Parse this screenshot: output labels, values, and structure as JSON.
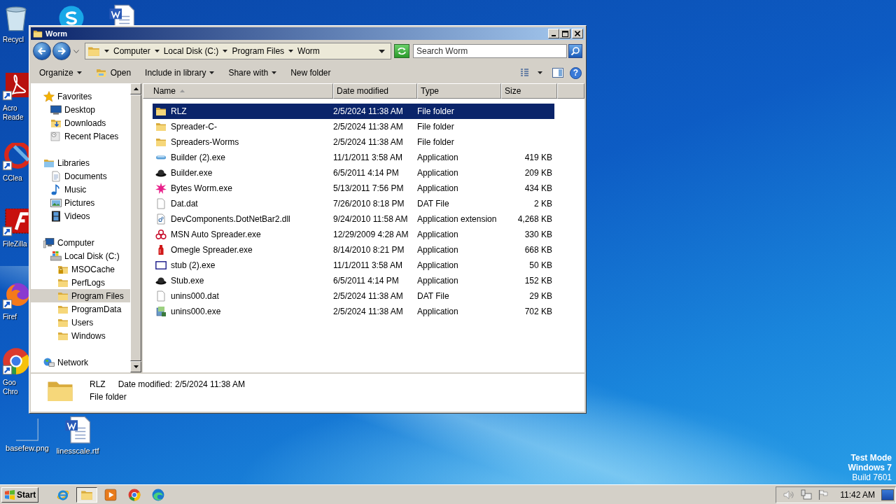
{
  "desktop": {
    "icons": [
      {
        "kind": "recycle",
        "label": "Recycl"
      },
      {
        "kind": "skype"
      },
      {
        "kind": "word"
      },
      {
        "kind": "acrobat",
        "label": "Acro Reade"
      },
      {
        "kind": "ccleaner",
        "label": "CClea"
      },
      {
        "kind": "filezilla",
        "label": "FileZilla"
      },
      {
        "kind": "firefox",
        "label": "Firef"
      },
      {
        "kind": "chrome",
        "label": "Goo Chro"
      },
      {
        "kind": "image",
        "label": "basefew.png"
      },
      {
        "kind": "word",
        "label": "linesscale.rtf"
      }
    ],
    "os_notice": {
      "title": "Test Mode",
      "edition": "Windows 7",
      "build": "Build 7601"
    }
  },
  "window": {
    "title": "Worm",
    "address": [
      "Computer",
      "Local Disk (C:)",
      "Program Files",
      "Worm"
    ],
    "search": {
      "placeholder": "Search Worm"
    },
    "toolbar": [
      {
        "label": "Organize",
        "kind": "menu"
      },
      {
        "label": "Open",
        "kind": "open"
      },
      {
        "label": "Include in library",
        "kind": "menu"
      },
      {
        "label": "Share with",
        "kind": "menu"
      },
      {
        "label": "New folder",
        "kind": "plain"
      }
    ],
    "help": "?",
    "nav": [
      {
        "label": "Favorites",
        "kind": "star",
        "selected": false,
        "children": [
          {
            "label": "Desktop",
            "kind": "monitor",
            "selected": false
          },
          {
            "label": "Downloads",
            "kind": "downloads",
            "selected": false
          },
          {
            "label": "Recent Places",
            "kind": "recent",
            "selected": false
          }
        ]
      },
      {
        "label": "Libraries",
        "kind": "library",
        "selected": false,
        "children": [
          {
            "label": "Documents",
            "kind": "documents",
            "selected": false
          },
          {
            "label": "Music",
            "kind": "music",
            "selected": false
          },
          {
            "label": "Pictures",
            "kind": "pictures",
            "selected": false
          },
          {
            "label": "Videos",
            "kind": "videos",
            "selected": false
          }
        ]
      },
      {
        "label": "Computer",
        "kind": "computer",
        "selected": false,
        "children": [
          {
            "label": "Local Disk (C:)",
            "kind": "drive",
            "selected": false,
            "children": [
              {
                "label": "MSOCache",
                "kind": "lockfolder",
                "selected": false
              },
              {
                "label": "PerfLogs",
                "kind": "folder",
                "selected": false
              },
              {
                "label": "Program Files",
                "kind": "folder",
                "selected": true
              },
              {
                "label": "ProgramData",
                "kind": "folder",
                "selected": false
              },
              {
                "label": "Users",
                "kind": "folder",
                "selected": false
              },
              {
                "label": "Windows",
                "kind": "folder",
                "selected": false
              }
            ]
          }
        ]
      },
      {
        "label": "Network",
        "kind": "network",
        "selected": false
      }
    ],
    "columns": [
      {
        "label": "Name",
        "sorted": true
      },
      {
        "label": "Date modified",
        "sorted": false
      },
      {
        "label": "Type",
        "sorted": false
      },
      {
        "label": "Size",
        "sorted": false
      }
    ],
    "rows": [
      {
        "name": "RLZ",
        "kind": "folder",
        "date": "2/5/2024 11:38 AM",
        "type": "File folder",
        "selected": true
      },
      {
        "name": "Spreader-C-",
        "kind": "folder",
        "date": "2/5/2024 11:38 AM",
        "type": "File folder",
        "selected": false
      },
      {
        "name": "Spreaders-Worms",
        "kind": "folder",
        "date": "2/5/2024 11:38 AM",
        "type": "File folder",
        "selected": false
      },
      {
        "name": "Builder (2).exe",
        "kind": "capsule",
        "date": "11/1/2011 3:58 AM",
        "type": "Application",
        "size": "419 KB",
        "selected": false
      },
      {
        "name": "Builder.exe",
        "kind": "hat",
        "date": "6/5/2011 4:14 PM",
        "type": "Application",
        "size": "209 KB",
        "selected": false
      },
      {
        "name": "Bytes Worm.exe",
        "kind": "splat",
        "date": "5/13/2011 7:56 PM",
        "type": "Application",
        "size": "434 KB",
        "selected": false
      },
      {
        "name": "Dat.dat",
        "kind": "file",
        "date": "7/26/2010 8:18 PM",
        "type": "DAT File",
        "size": "2 KB",
        "selected": false
      },
      {
        "name": "DevComponents.DotNetBar2.dll",
        "kind": "dll",
        "date": "9/24/2010 11:58 AM",
        "type": "Application extension",
        "size": "4,268 KB",
        "selected": false
      },
      {
        "name": "MSN Auto Spreader.exe",
        "kind": "biohazard",
        "date": "12/29/2009 4:28 AM",
        "type": "Application",
        "size": "330 KB",
        "selected": false
      },
      {
        "name": "Omegle Spreader.exe",
        "kind": "bottle",
        "date": "8/14/2010 8:21 PM",
        "type": "Application",
        "size": "668 KB",
        "selected": false
      },
      {
        "name": "stub (2).exe",
        "kind": "window",
        "date": "11/1/2011 3:58 AM",
        "type": "Application",
        "size": "50 KB",
        "selected": false
      },
      {
        "name": "Stub.exe",
        "kind": "hat",
        "date": "6/5/2011 4:14 PM",
        "type": "Application",
        "size": "152 KB",
        "selected": false
      },
      {
        "name": "unins000.dat",
        "kind": "file",
        "date": "2/5/2024 11:38 AM",
        "type": "DAT File",
        "size": "29 KB",
        "selected": false
      },
      {
        "name": "unins000.exe",
        "kind": "installer",
        "date": "2/5/2024 11:38 AM",
        "type": "Application",
        "size": "702 KB",
        "selected": false
      }
    ],
    "details": {
      "name": "RLZ",
      "date_label": "Date modified:",
      "date": "2/5/2024 11:38 AM",
      "type": "File folder"
    }
  },
  "taskbar": {
    "start": "Start",
    "apps": [
      {
        "kind": "ie",
        "selected": false
      },
      {
        "kind": "explorer",
        "selected": true
      },
      {
        "kind": "media",
        "selected": false
      },
      {
        "kind": "chrome",
        "selected": false
      },
      {
        "kind": "edge",
        "selected": false
      }
    ],
    "time": "11:42 AM"
  }
}
